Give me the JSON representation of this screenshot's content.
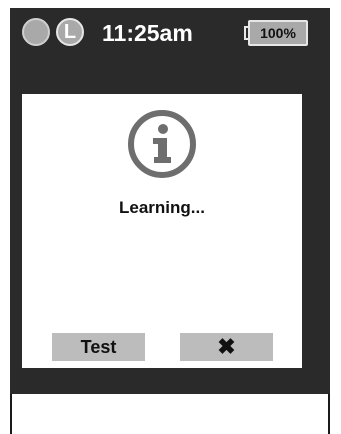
{
  "status_bar": {
    "indicator_letter": "L",
    "time": "11:25am",
    "battery_label": "100%"
  },
  "dialog": {
    "icon": "info-circle-icon",
    "message": "Learning...",
    "test_button_label": "Test",
    "close_button_label": "✖"
  },
  "colors": {
    "bar_background": "#2a2a2a",
    "button_gray": "#bcbcbc",
    "icon_gray": "#6e6e6e"
  }
}
